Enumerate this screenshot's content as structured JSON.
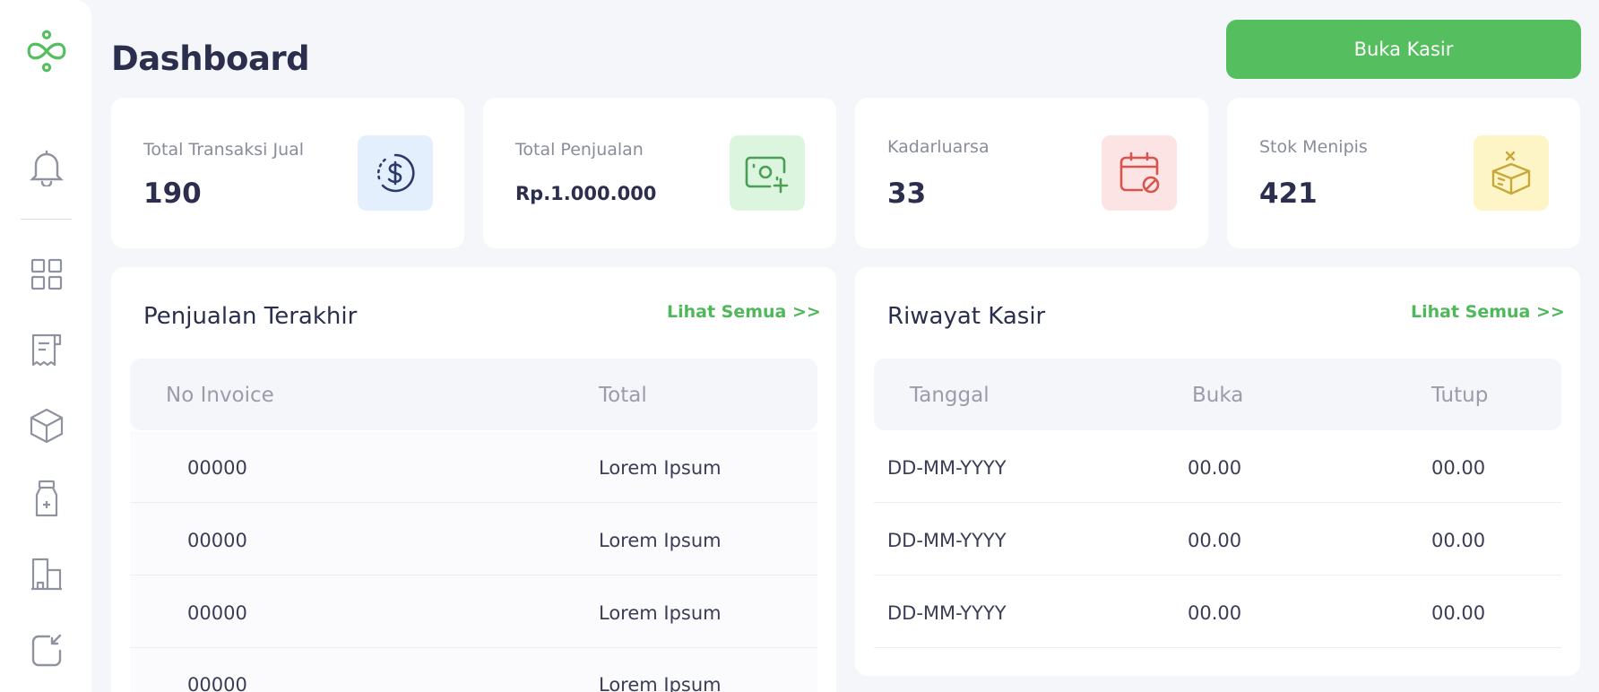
{
  "header": {
    "title": "Dashboard",
    "open_cashier_label": "Buka Kasir"
  },
  "sidebar": {
    "items": [
      {
        "icon": "bell-icon"
      },
      {
        "icon": "grid-icon"
      },
      {
        "icon": "receipt-icon"
      },
      {
        "icon": "box-icon"
      },
      {
        "icon": "medicine-bottle-icon"
      },
      {
        "icon": "building-icon"
      },
      {
        "icon": "logout-icon"
      }
    ]
  },
  "stats": [
    {
      "label": "Total Transaksi Jual",
      "value": "190",
      "icon": "dollar-refresh-icon",
      "color": "#e4effd"
    },
    {
      "label": "Total Penjualan",
      "value": "Rp.1.000.000",
      "icon": "money-add-icon",
      "color": "#dcf5df"
    },
    {
      "label": "Kadarluarsa",
      "value": "33",
      "icon": "calendar-block-icon",
      "color": "#fde4e4"
    },
    {
      "label": "Stok Menipis",
      "value": "421",
      "icon": "box-remove-icon",
      "color": "#fdf5c6"
    }
  ],
  "recent_sales": {
    "title": "Penjualan Terakhir",
    "see_all": "Lihat Semua >>",
    "columns": [
      "No Invoice",
      "Total"
    ],
    "rows": [
      [
        "00000",
        "Lorem Ipsum"
      ],
      [
        "00000",
        "Lorem Ipsum"
      ],
      [
        "00000",
        "Lorem Ipsum"
      ],
      [
        "00000",
        "Lorem Ipsum"
      ]
    ]
  },
  "cashier_history": {
    "title": "Riwayat Kasir",
    "see_all": "Lihat Semua >>",
    "columns": [
      "Tanggal",
      "Buka",
      "Tutup"
    ],
    "rows": [
      [
        "DD-MM-YYYY",
        "00.00",
        "00.00"
      ],
      [
        "DD-MM-YYYY",
        "00.00",
        "00.00"
      ],
      [
        "DD-MM-YYYY",
        "00.00",
        "00.00"
      ]
    ]
  },
  "colors": {
    "accent": "#55be5f",
    "text": "#2b2f4d",
    "background": "#f5f6fa"
  }
}
